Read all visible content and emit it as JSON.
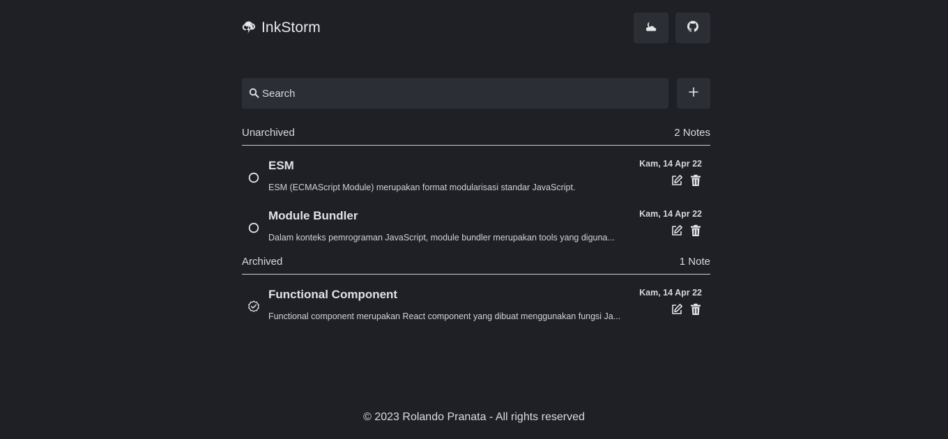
{
  "header": {
    "brand_title": "InkStorm",
    "brand_icon": "cloud-lightning-icon",
    "theme_toggle_icon": "moon-cloud-icon",
    "github_icon": "github-icon"
  },
  "search": {
    "placeholder": "Search",
    "value": "",
    "icon": "search-icon"
  },
  "add_button": {
    "icon": "plus-icon"
  },
  "sections": {
    "unarchived": {
      "title": "Unarchived",
      "count": "2 Notes",
      "notes": [
        {
          "title": "ESM",
          "body": "ESM (ECMAScript Module) merupakan format modularisasi standar JavaScript.",
          "date": "Kam, 14 Apr 22",
          "status_icon": "circle-icon"
        },
        {
          "title": "Module Bundler",
          "body": "Dalam konteks pemrograman JavaScript, module bundler merupakan tools yang diguna...",
          "date": "Kam, 14 Apr 22",
          "status_icon": "circle-icon"
        }
      ]
    },
    "archived": {
      "title": "Archived",
      "count": "1 Note",
      "notes": [
        {
          "title": "Functional Component",
          "body": "Functional component merupakan React component yang dibuat menggunakan fungsi Ja...",
          "date": "Kam, 14 Apr 22",
          "status_icon": "badge-check-icon"
        }
      ]
    }
  },
  "footer": {
    "text": "© 2023 Rolando Pranata - All rights reserved"
  },
  "colors": {
    "background": "#1f2026",
    "surface": "#2c2e36",
    "text": "#e6e6e8",
    "divider": "#cfd0d4"
  }
}
